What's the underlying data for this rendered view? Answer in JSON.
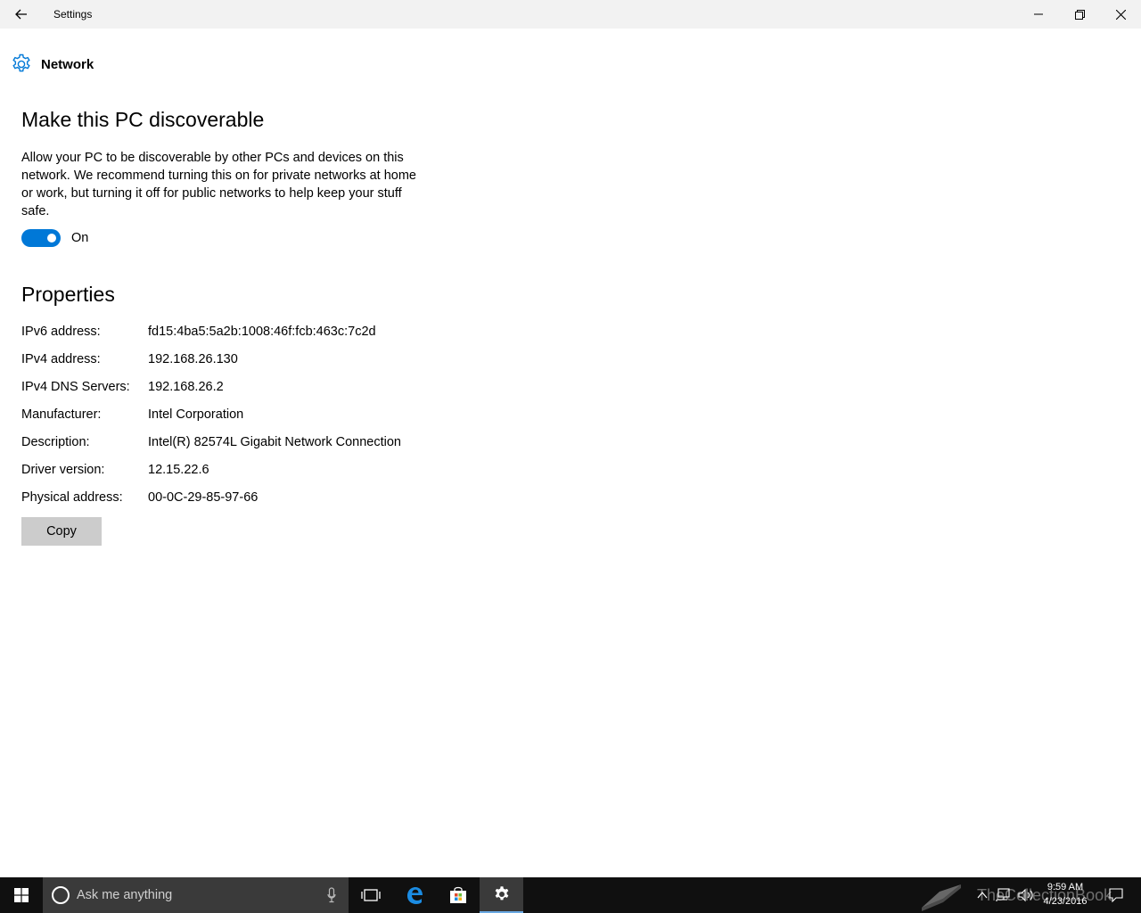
{
  "window": {
    "title": "Settings"
  },
  "header": {
    "label": "Network"
  },
  "discoverable": {
    "title": "Make this PC discoverable",
    "description": "Allow your PC to be discoverable by other PCs and devices on this network. We recommend turning this on for private networks at home or work, but turning it off for public networks to help keep your stuff safe.",
    "toggle_state": "On",
    "toggle_on": true
  },
  "properties": {
    "title": "Properties",
    "rows": [
      {
        "key": "IPv6 address:",
        "value": "fd15:4ba5:5a2b:1008:46f:fcb:463c:7c2d"
      },
      {
        "key": "IPv4 address:",
        "value": "192.168.26.130"
      },
      {
        "key": "IPv4 DNS Servers:",
        "value": "192.168.26.2"
      },
      {
        "key": "Manufacturer:",
        "value": "Intel Corporation"
      },
      {
        "key": "Description:",
        "value": "Intel(R) 82574L Gigabit Network Connection"
      },
      {
        "key": "Driver version:",
        "value": "12.15.22.6"
      },
      {
        "key": "Physical address:",
        "value": "00-0C-29-85-97-66"
      }
    ],
    "copy_label": "Copy"
  },
  "taskbar": {
    "search_placeholder": "Ask me anything",
    "watermark": "TheCollectionBook",
    "time": "9:59 AM",
    "date": "4/23/2016"
  },
  "colors": {
    "accent": "#0078d7",
    "taskbar": "#101010"
  }
}
